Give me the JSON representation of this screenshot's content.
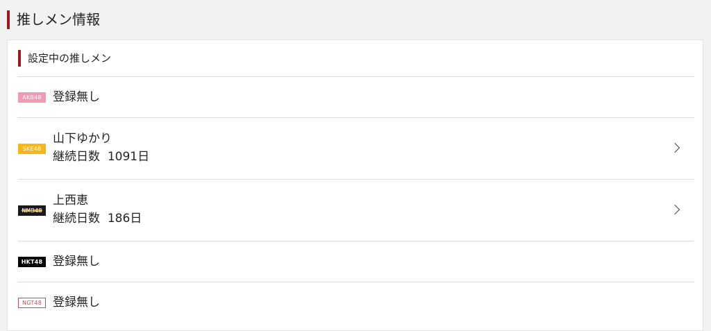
{
  "header": {
    "title": "推しメン情報"
  },
  "section": {
    "title": "設定中の推しメン"
  },
  "groups": [
    {
      "badge": "AKB48",
      "name": "登録無し",
      "days_label": "",
      "days": ""
    },
    {
      "badge": "SKE48",
      "name": "山下ゆかり",
      "days_label": "継続日数",
      "days": "1091日"
    },
    {
      "badge": "NMB48",
      "name": "上西恵",
      "days_label": "継続日数",
      "days": "186日"
    },
    {
      "badge": "HKT48",
      "name": "登録無し",
      "days_label": "",
      "days": ""
    },
    {
      "badge": "NGT48",
      "name": "登録無し",
      "days_label": "",
      "days": ""
    }
  ],
  "colors": {
    "accent": "#9b1b1b",
    "akb48": "#f19ab3",
    "ske48": "#f5b81c",
    "nmb48": "#1a1a1a",
    "hkt48": "#000000",
    "ngt48": "#c24a5b"
  },
  "icons": {
    "chevron": "chevron-right-icon"
  }
}
